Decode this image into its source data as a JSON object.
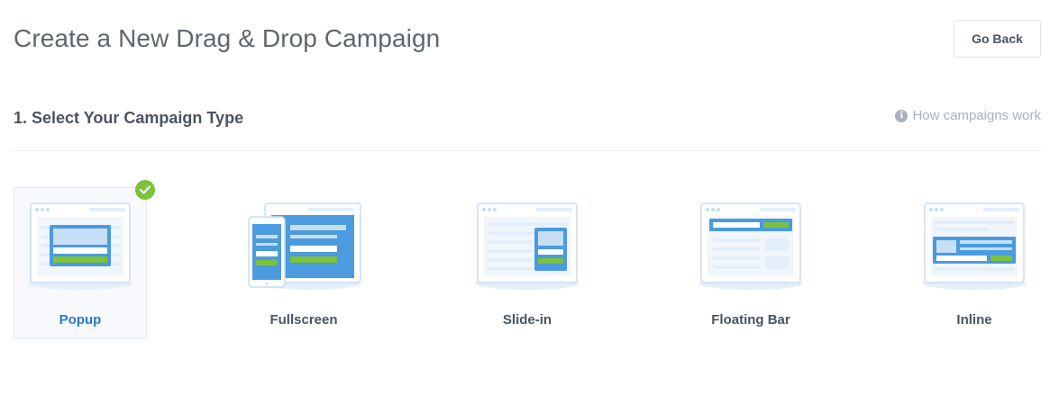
{
  "header": {
    "title": "Create a New Drag & Drop Campaign",
    "go_back_label": "Go Back"
  },
  "section": {
    "title": "1. Select Your Campaign Type",
    "help_link": "How campaigns work",
    "help_icon": "info-icon"
  },
  "campaign_types": [
    {
      "label": "Popup",
      "icon": "popup-icon",
      "selected": true
    },
    {
      "label": "Fullscreen",
      "icon": "fullscreen-icon",
      "selected": false
    },
    {
      "label": "Slide-in",
      "icon": "slide-in-icon",
      "selected": false
    },
    {
      "label": "Floating Bar",
      "icon": "floating-bar-icon",
      "selected": false
    },
    {
      "label": "Inline",
      "icon": "inline-icon",
      "selected": false
    }
  ],
  "colors": {
    "accent_blue": "#2b7bca",
    "illustration_blue": "#4a9be0",
    "success_green": "#7cc23a",
    "text": "#4a5560",
    "muted": "#a9b2ba"
  }
}
